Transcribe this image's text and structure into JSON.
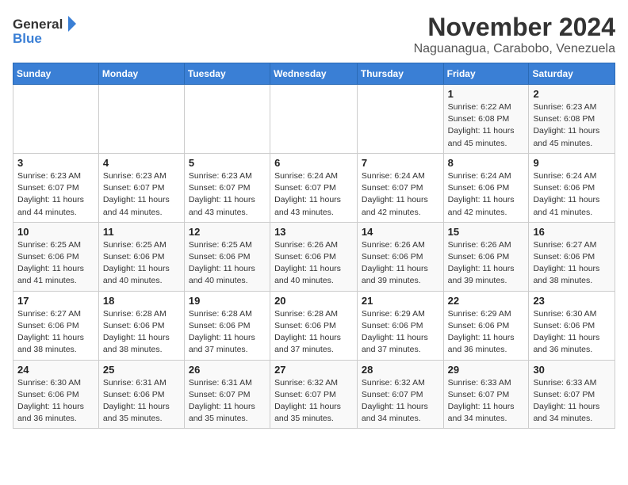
{
  "header": {
    "logo": {
      "general": "General",
      "blue": "Blue"
    },
    "title": "November 2024",
    "subtitle": "Naguanagua, Carabobo, Venezuela"
  },
  "days_of_week": [
    "Sunday",
    "Monday",
    "Tuesday",
    "Wednesday",
    "Thursday",
    "Friday",
    "Saturday"
  ],
  "weeks": [
    [
      {
        "day": "",
        "info": ""
      },
      {
        "day": "",
        "info": ""
      },
      {
        "day": "",
        "info": ""
      },
      {
        "day": "",
        "info": ""
      },
      {
        "day": "",
        "info": ""
      },
      {
        "day": "1",
        "info": "Sunrise: 6:22 AM\nSunset: 6:08 PM\nDaylight: 11 hours and 45 minutes."
      },
      {
        "day": "2",
        "info": "Sunrise: 6:23 AM\nSunset: 6:08 PM\nDaylight: 11 hours and 45 minutes."
      }
    ],
    [
      {
        "day": "3",
        "info": "Sunrise: 6:23 AM\nSunset: 6:07 PM\nDaylight: 11 hours and 44 minutes."
      },
      {
        "day": "4",
        "info": "Sunrise: 6:23 AM\nSunset: 6:07 PM\nDaylight: 11 hours and 44 minutes."
      },
      {
        "day": "5",
        "info": "Sunrise: 6:23 AM\nSunset: 6:07 PM\nDaylight: 11 hours and 43 minutes."
      },
      {
        "day": "6",
        "info": "Sunrise: 6:24 AM\nSunset: 6:07 PM\nDaylight: 11 hours and 43 minutes."
      },
      {
        "day": "7",
        "info": "Sunrise: 6:24 AM\nSunset: 6:07 PM\nDaylight: 11 hours and 42 minutes."
      },
      {
        "day": "8",
        "info": "Sunrise: 6:24 AM\nSunset: 6:06 PM\nDaylight: 11 hours and 42 minutes."
      },
      {
        "day": "9",
        "info": "Sunrise: 6:24 AM\nSunset: 6:06 PM\nDaylight: 11 hours and 41 minutes."
      }
    ],
    [
      {
        "day": "10",
        "info": "Sunrise: 6:25 AM\nSunset: 6:06 PM\nDaylight: 11 hours and 41 minutes."
      },
      {
        "day": "11",
        "info": "Sunrise: 6:25 AM\nSunset: 6:06 PM\nDaylight: 11 hours and 40 minutes."
      },
      {
        "day": "12",
        "info": "Sunrise: 6:25 AM\nSunset: 6:06 PM\nDaylight: 11 hours and 40 minutes."
      },
      {
        "day": "13",
        "info": "Sunrise: 6:26 AM\nSunset: 6:06 PM\nDaylight: 11 hours and 40 minutes."
      },
      {
        "day": "14",
        "info": "Sunrise: 6:26 AM\nSunset: 6:06 PM\nDaylight: 11 hours and 39 minutes."
      },
      {
        "day": "15",
        "info": "Sunrise: 6:26 AM\nSunset: 6:06 PM\nDaylight: 11 hours and 39 minutes."
      },
      {
        "day": "16",
        "info": "Sunrise: 6:27 AM\nSunset: 6:06 PM\nDaylight: 11 hours and 38 minutes."
      }
    ],
    [
      {
        "day": "17",
        "info": "Sunrise: 6:27 AM\nSunset: 6:06 PM\nDaylight: 11 hours and 38 minutes."
      },
      {
        "day": "18",
        "info": "Sunrise: 6:28 AM\nSunset: 6:06 PM\nDaylight: 11 hours and 38 minutes."
      },
      {
        "day": "19",
        "info": "Sunrise: 6:28 AM\nSunset: 6:06 PM\nDaylight: 11 hours and 37 minutes."
      },
      {
        "day": "20",
        "info": "Sunrise: 6:28 AM\nSunset: 6:06 PM\nDaylight: 11 hours and 37 minutes."
      },
      {
        "day": "21",
        "info": "Sunrise: 6:29 AM\nSunset: 6:06 PM\nDaylight: 11 hours and 37 minutes."
      },
      {
        "day": "22",
        "info": "Sunrise: 6:29 AM\nSunset: 6:06 PM\nDaylight: 11 hours and 36 minutes."
      },
      {
        "day": "23",
        "info": "Sunrise: 6:30 AM\nSunset: 6:06 PM\nDaylight: 11 hours and 36 minutes."
      }
    ],
    [
      {
        "day": "24",
        "info": "Sunrise: 6:30 AM\nSunset: 6:06 PM\nDaylight: 11 hours and 36 minutes."
      },
      {
        "day": "25",
        "info": "Sunrise: 6:31 AM\nSunset: 6:06 PM\nDaylight: 11 hours and 35 minutes."
      },
      {
        "day": "26",
        "info": "Sunrise: 6:31 AM\nSunset: 6:07 PM\nDaylight: 11 hours and 35 minutes."
      },
      {
        "day": "27",
        "info": "Sunrise: 6:32 AM\nSunset: 6:07 PM\nDaylight: 11 hours and 35 minutes."
      },
      {
        "day": "28",
        "info": "Sunrise: 6:32 AM\nSunset: 6:07 PM\nDaylight: 11 hours and 34 minutes."
      },
      {
        "day": "29",
        "info": "Sunrise: 6:33 AM\nSunset: 6:07 PM\nDaylight: 11 hours and 34 minutes."
      },
      {
        "day": "30",
        "info": "Sunrise: 6:33 AM\nSunset: 6:07 PM\nDaylight: 11 hours and 34 minutes."
      }
    ]
  ]
}
